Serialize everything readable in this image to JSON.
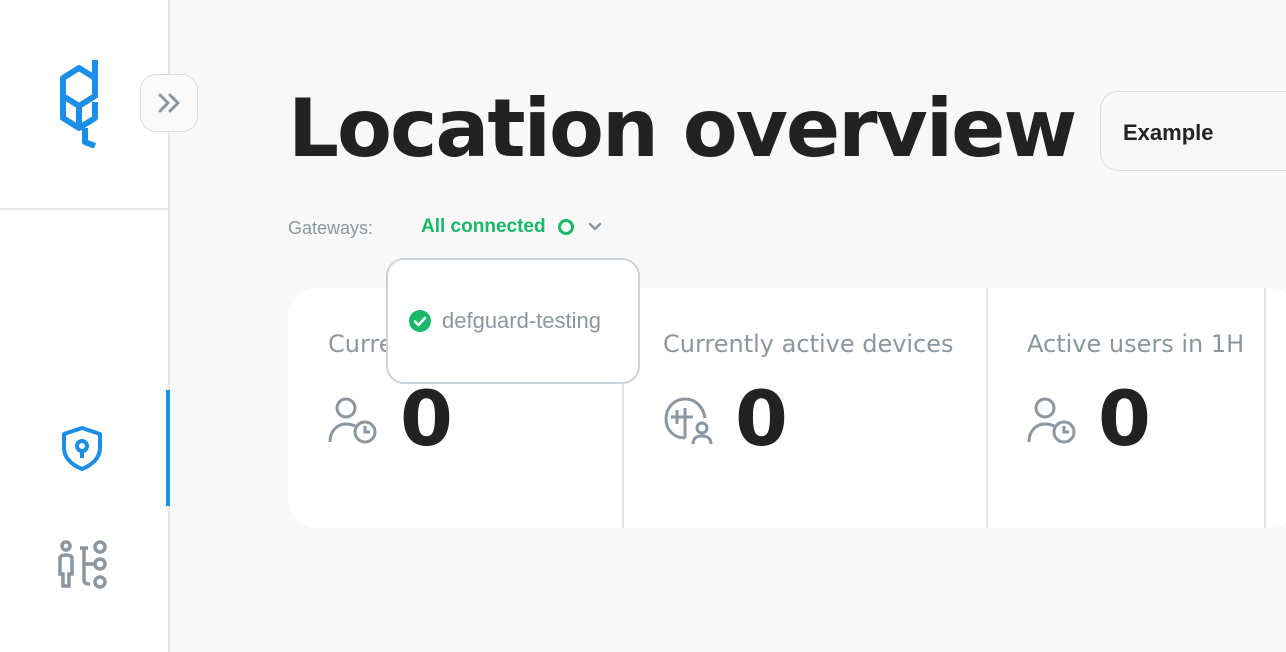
{
  "page": {
    "title": "Location overview"
  },
  "location_select": {
    "value": "Example"
  },
  "gateways": {
    "label": "Gateways:",
    "status": "All connected",
    "dropdown_items": [
      {
        "name": "defguard-testing",
        "status": "connected"
      }
    ]
  },
  "stats": [
    {
      "label": "Currently active users",
      "value": "0",
      "icon": "user-clock-icon"
    },
    {
      "label": "Currently active devices",
      "value": "0",
      "icon": "network-device-icon"
    },
    {
      "label": "Active users in 1H",
      "value": "0",
      "icon": "user-clock-icon"
    }
  ],
  "sidebar": {
    "items": [
      {
        "name": "vpn-locations",
        "icon": "shield-lock-icon",
        "active": true
      },
      {
        "name": "network-devices",
        "icon": "devices-icon",
        "active": false
      }
    ]
  },
  "colors": {
    "accent": "#1b8ee8",
    "success": "#19b869",
    "muted_text": "#8a96a0",
    "title_text": "#222222"
  }
}
